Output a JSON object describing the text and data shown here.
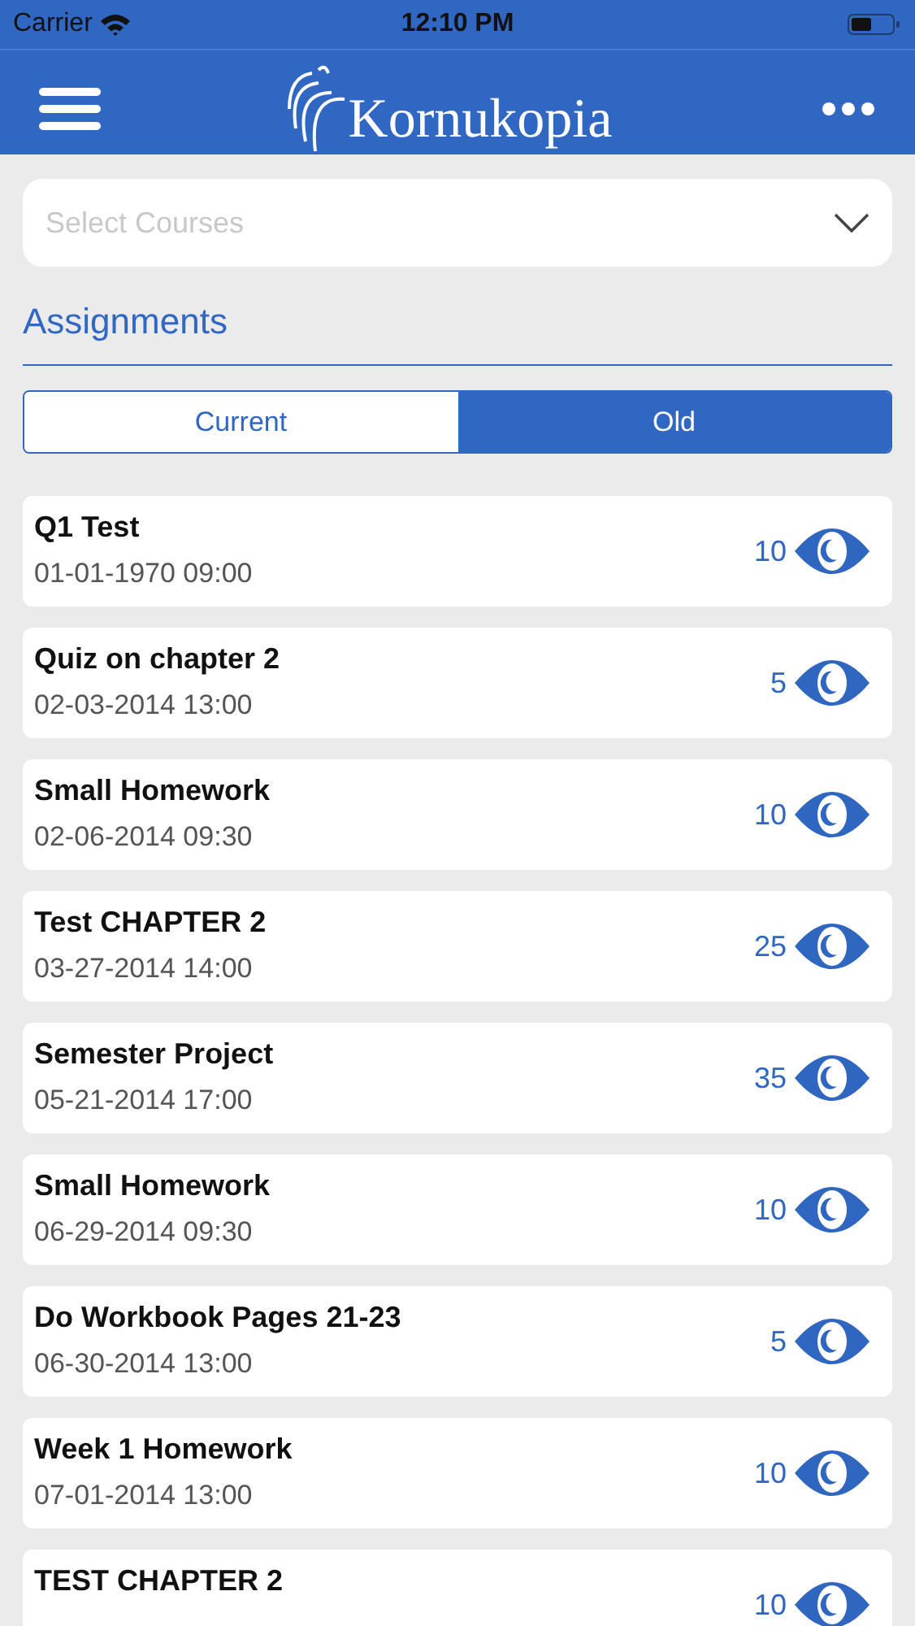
{
  "status_bar": {
    "carrier": "Carrier",
    "time": "12:10 PM"
  },
  "header": {
    "logo_text": "Kornukopia"
  },
  "course_select": {
    "placeholder": "Select Courses"
  },
  "section_title": "Assignments",
  "tabs": [
    {
      "label": "Current",
      "selected": false
    },
    {
      "label": "Old",
      "selected": true
    }
  ],
  "assignments": [
    {
      "title": "Q1 Test",
      "date": "01-01-1970 09:00",
      "score": "10"
    },
    {
      "title": "Quiz on chapter 2",
      "date": "02-03-2014 13:00",
      "score": "5"
    },
    {
      "title": "Small Homework",
      "date": "02-06-2014 09:30",
      "score": "10"
    },
    {
      "title": "Test CHAPTER 2",
      "date": "03-27-2014 14:00",
      "score": "25"
    },
    {
      "title": "Semester Project",
      "date": "05-21-2014 17:00",
      "score": "35"
    },
    {
      "title": "Small Homework",
      "date": "06-29-2014 09:30",
      "score": "10"
    },
    {
      "title": "Do Workbook Pages 21-23",
      "date": "06-30-2014 13:00",
      "score": "5"
    },
    {
      "title": "Week 1 Homework",
      "date": "07-01-2014 13:00",
      "score": "10"
    },
    {
      "title": "TEST CHAPTER 2",
      "score": "10"
    }
  ]
}
